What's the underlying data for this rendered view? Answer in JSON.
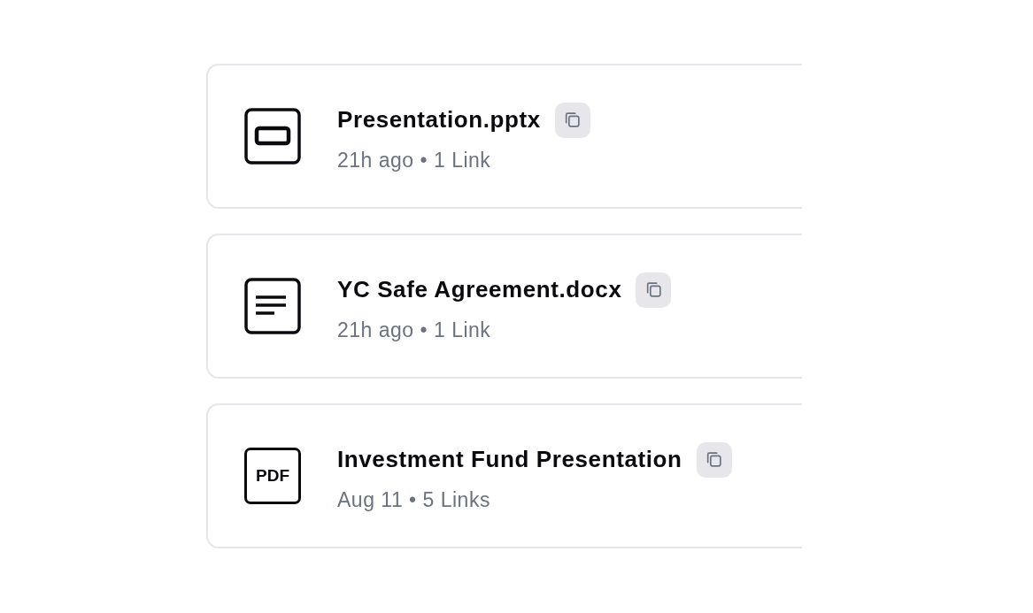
{
  "files": [
    {
      "kind": "slides",
      "name": "Presentation.pptx",
      "meta": "21h ago • 1 Link"
    },
    {
      "kind": "document",
      "name": "YC Safe Agreement.docx",
      "meta": "21h ago • 1 Link"
    },
    {
      "kind": "pdf",
      "icon_text": "PDF",
      "name": "Investment Fund Presentation",
      "meta": "Aug 11 • 5 Links"
    }
  ]
}
